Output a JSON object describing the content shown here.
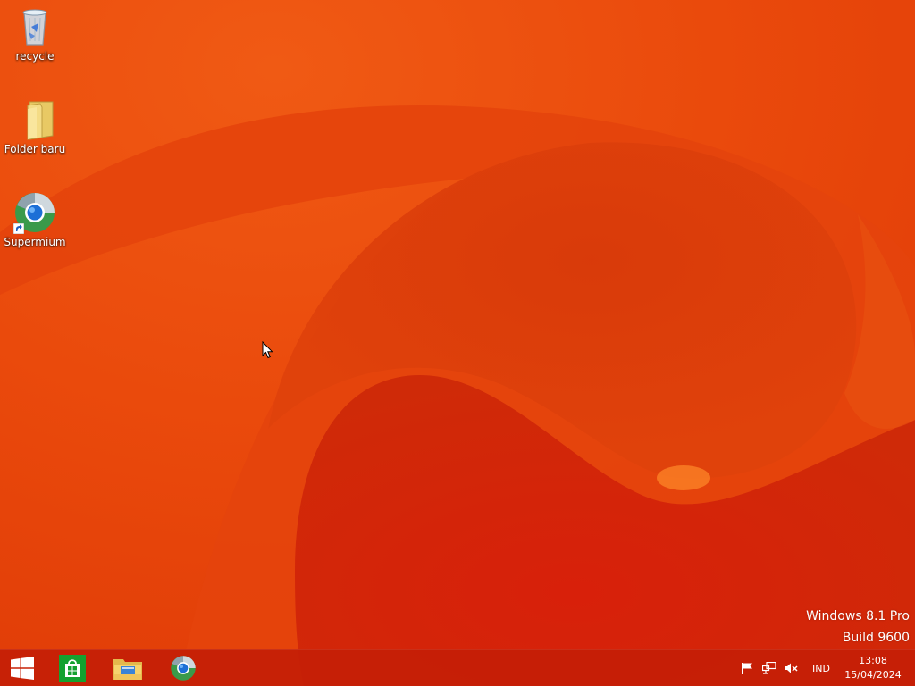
{
  "desktop": {
    "icons": [
      {
        "label": "recycle",
        "icon": "recycle-bin-icon"
      },
      {
        "label": "Folder baru",
        "icon": "folder-icon"
      },
      {
        "label": "Supermium",
        "icon": "supermium-icon"
      }
    ]
  },
  "watermark": {
    "line1": "Windows 8.1 Pro",
    "line2": "Build 9600"
  },
  "taskbar": {
    "pinned": [
      {
        "icon": "windows-logo-icon"
      },
      {
        "icon": "store-icon"
      },
      {
        "icon": "file-explorer-icon"
      },
      {
        "icon": "supermium-icon"
      }
    ],
    "tray": {
      "flag_icon": "action-center-flag-icon",
      "network_icon": "network-icon",
      "volume_icon": "volume-muted-icon",
      "language": "IND",
      "time": "13:08",
      "date": "15/04/2024"
    }
  },
  "colors": {
    "wallpaper": "#e8470e",
    "taskbar": "#c41e06"
  }
}
